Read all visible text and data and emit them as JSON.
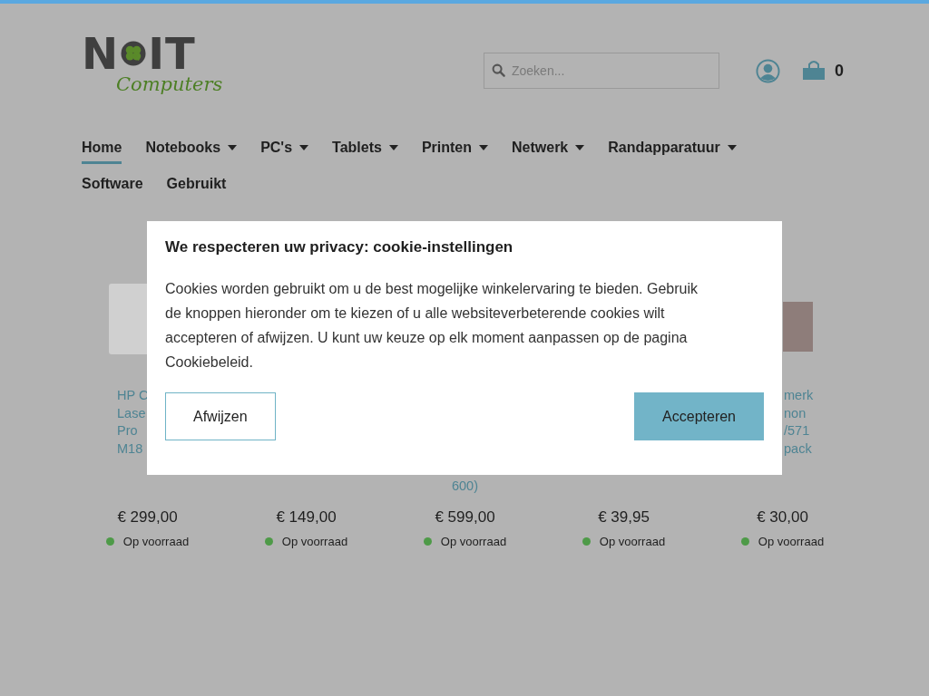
{
  "logo": {
    "word": "N",
    "word_end": "IT",
    "tagline": "Computers"
  },
  "search": {
    "placeholder": "Zoeken..."
  },
  "cart": {
    "count": "0"
  },
  "nav": [
    {
      "label": "Home",
      "selected": true,
      "dropdown": false
    },
    {
      "label": "Notebooks",
      "selected": false,
      "dropdown": true
    },
    {
      "label": "PC's",
      "selected": false,
      "dropdown": true
    },
    {
      "label": "Tablets",
      "selected": false,
      "dropdown": true
    },
    {
      "label": "Printen",
      "selected": false,
      "dropdown": true
    },
    {
      "label": "Netwerk",
      "selected": false,
      "dropdown": true
    },
    {
      "label": "Randapparatuur",
      "selected": false,
      "dropdown": true
    },
    {
      "label": "Software",
      "selected": false,
      "dropdown": false
    },
    {
      "label": "Gebruikt",
      "selected": false,
      "dropdown": false
    }
  ],
  "products": [
    {
      "title_lines": [
        "HP C",
        "Lase",
        "Pro",
        "M18"
      ],
      "price": "€ 299,00",
      "stock": "Op voorraad",
      "in_stock": true
    },
    {
      "price": "€ 149,00",
      "stock": "Op voorraad",
      "in_stock": true
    },
    {
      "title_lines": [
        "600)"
      ],
      "price": "€ 599,00",
      "stock": "Op voorraad",
      "in_stock": true
    },
    {
      "price": "€ 39,95",
      "stock": "Op voorraad",
      "in_stock": true
    },
    {
      "title_lines": [
        "merk",
        "non",
        "/571",
        "pack"
      ],
      "price": "€ 30,00",
      "stock": "Op voorraad",
      "in_stock": true
    }
  ],
  "cookie_dialog": {
    "title": "We respecteren uw privacy: cookie-instellingen",
    "text": "Cookies worden gebruikt om u de best mogelijke winkelervaring te bieden. Gebruik de knoppen hieronder om te kiezen of u alle websiteverbeterende cookies wilt accepteren of afwijzen. U kunt uw keuze op elk moment aanpassen op de pagina Cookiebeleid.",
    "buttons": [
      {
        "label": "Afwijzen",
        "kind": "outline"
      },
      {
        "label": "Accepteren",
        "kind": "primary"
      }
    ]
  }
}
